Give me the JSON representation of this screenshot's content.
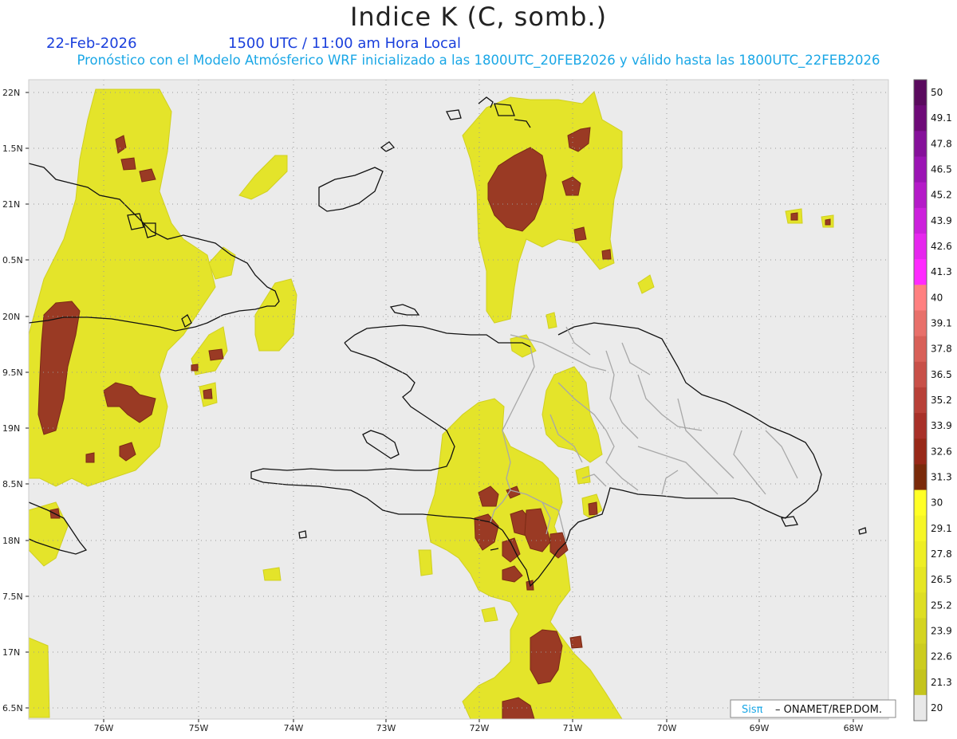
{
  "header": {
    "title": "Indice K (C, somb.)",
    "date": "22-Feb-2026",
    "time": "1500 UTC / 11:00 am Hora Local",
    "subtitle": "Pronóstico con el Modelo Atmósferico WRF inicializado a las 1800UTC_20FEB2026 y válido hasta las  1800UTC_22FEB2026"
  },
  "map": {
    "lat_labels": [
      "22N",
      "1.5N",
      "21N",
      "0.5N",
      "20N",
      "9.5N",
      "19N",
      "8.5N",
      "18N",
      "7.5N",
      "17N",
      "6.5N"
    ],
    "lon_labels": [
      "76W",
      "75W",
      "74W",
      "73W",
      "72W",
      "71W",
      "70W",
      "69W",
      "68W"
    ]
  },
  "colorbar": {
    "labels": [
      "50",
      "49.1",
      "47.8",
      "46.5",
      "45.2",
      "43.9",
      "42.6",
      "41.3",
      "40",
      "39.1",
      "37.8",
      "36.5",
      "35.2",
      "33.9",
      "32.6",
      "31.3",
      "30",
      "29.1",
      "27.8",
      "26.5",
      "25.2",
      "23.9",
      "22.6",
      "21.3",
      "20"
    ],
    "colors": [
      "#5a0a5e",
      "#6e0a78",
      "#85109a",
      "#9b14b4",
      "#b41ac8",
      "#cc20dc",
      "#e626ee",
      "#ff2aff",
      "#ff8080",
      "#e8706a",
      "#d86058",
      "#c85048",
      "#b84038",
      "#a83028",
      "#982818",
      "#7a2a0a",
      "#ffff26",
      "#f6f626",
      "#eeee24",
      "#e6e622",
      "#dede22",
      "#d4d420",
      "#cccc1e",
      "#c4c41c",
      "#e8e8e8"
    ]
  },
  "credit": {
    "brand": "Sisπ",
    "org": "– ONAMET/REP.DOM."
  }
}
